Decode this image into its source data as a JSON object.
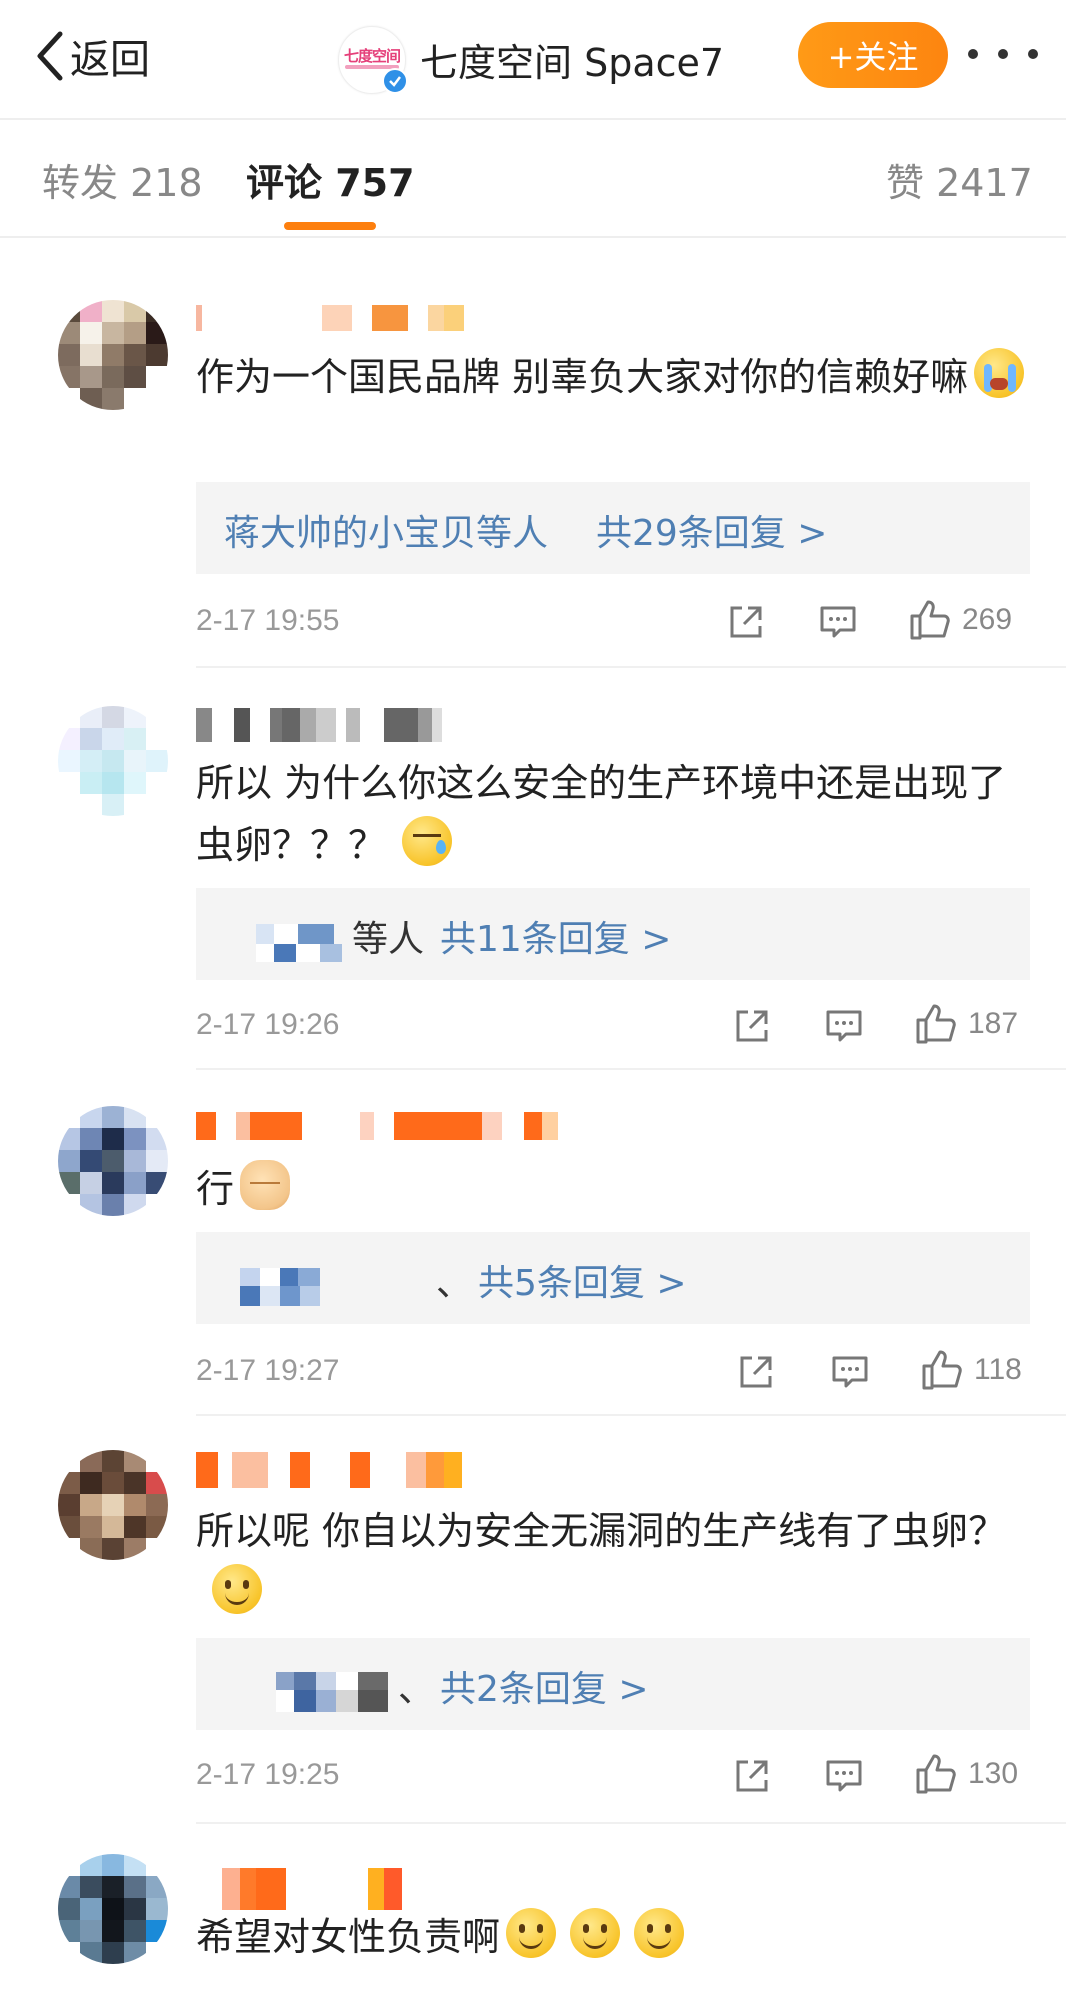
{
  "header": {
    "back_label": "返回",
    "logo_text": "七度空间",
    "account_name": "七度空间 Space7",
    "follow_label": "+关注",
    "accent_color": "#fd8510"
  },
  "tabs": [
    {
      "label": "转发 218"
    },
    {
      "label": "评论 757"
    },
    {
      "label": "赞 2417"
    }
  ],
  "comments": [
    {
      "text": "作为一个国民品牌 别辜负大家对你的信赖好嘛",
      "emoji": "crying-face",
      "reply_prefix": "蒋大帅的小宝贝等人",
      "reply_label": "共29条回复 >",
      "time": "2-17 19:55",
      "likes": "269"
    },
    {
      "text": "所以 为什么你这么安全的生产环境中还是出现了虫卵？？？",
      "emoji": "sweat-face",
      "reply_prefix": "等人",
      "reply_label": "共11条回复 >",
      "time": "2-17 19:26",
      "likes": "187"
    },
    {
      "text": "行",
      "emoji": "fist",
      "reply_prefix": "、",
      "reply_label": "共5条回复 >",
      "time": "2-17 19:27",
      "likes": "118"
    },
    {
      "text": "所以呢  你自以为安全无漏洞的生产线有了虫卵？",
      "emoji": "smile-face",
      "reply_prefix": "、",
      "reply_label": "共2条回复 >",
      "time": "2-17 19:25",
      "likes": "130"
    },
    {
      "text": "希望对女性负责啊",
      "emoji": "smile-face x3"
    }
  ]
}
